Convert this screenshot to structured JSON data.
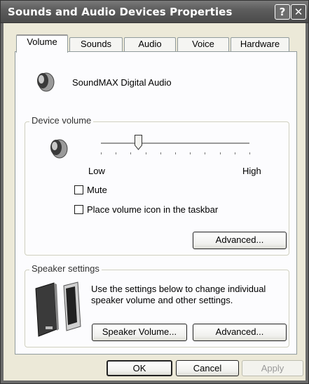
{
  "window": {
    "title": "Sounds and Audio Devices Properties",
    "help_glyph": "?",
    "close_glyph": "✕"
  },
  "tabs": [
    {
      "label": "Volume",
      "selected": true
    },
    {
      "label": "Sounds"
    },
    {
      "label": "Audio"
    },
    {
      "label": "Voice"
    },
    {
      "label": "Hardware"
    }
  ],
  "device": {
    "name": "SoundMAX Digital Audio"
  },
  "device_volume": {
    "group_label": "Device volume",
    "low_label": "Low",
    "high_label": "High",
    "level": 0.25,
    "mute_label": "Mute",
    "mute_checked": false,
    "taskbar_label": "Place volume icon in the taskbar",
    "taskbar_checked": false,
    "advanced_label": "Advanced..."
  },
  "speaker_settings": {
    "group_label": "Speaker settings",
    "description": "Use the settings below to change individual speaker volume and other settings.",
    "speaker_volume_label": "Speaker Volume...",
    "advanced_label": "Advanced..."
  },
  "footer": {
    "ok_label": "OK",
    "cancel_label": "Cancel",
    "apply_label": "Apply"
  }
}
